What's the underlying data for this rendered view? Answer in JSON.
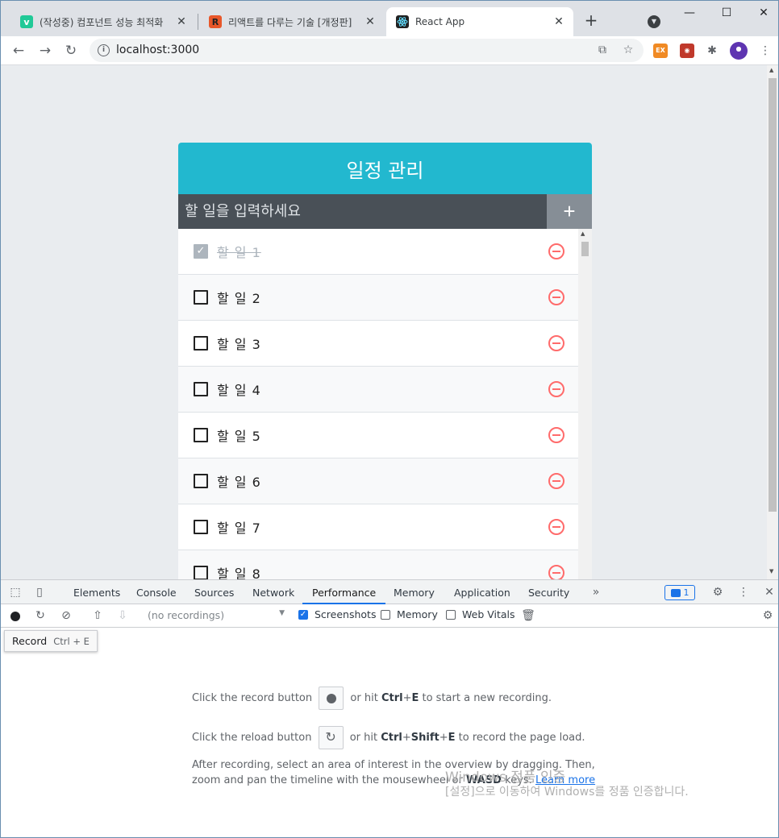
{
  "browser": {
    "tabs": [
      {
        "title": "(작성중) 컴포넌트 성능 최적화",
        "favicon": "v"
      },
      {
        "title": "리액트를 다루는 기술 [개정판]",
        "favicon": "R"
      },
      {
        "title": "React App",
        "favicon": "react-atom"
      }
    ],
    "url": "localhost:3000",
    "close_glyph": "✕",
    "new_tab_glyph": "+"
  },
  "app": {
    "title": "일정 관리",
    "input_placeholder": "할 일을 입력하세요",
    "add_label": "+",
    "todos": [
      {
        "text": "할 일 1",
        "checked": true
      },
      {
        "text": "할 일 2",
        "checked": false
      },
      {
        "text": "할 일 3",
        "checked": false
      },
      {
        "text": "할 일 4",
        "checked": false
      },
      {
        "text": "할 일 5",
        "checked": false
      },
      {
        "text": "할 일 6",
        "checked": false
      },
      {
        "text": "할 일 7",
        "checked": false
      },
      {
        "text": "할 일 8",
        "checked": false
      }
    ]
  },
  "devtools": {
    "tabs": [
      "Elements",
      "Console",
      "Sources",
      "Network",
      "Performance",
      "Memory",
      "Application",
      "Security"
    ],
    "active_tab": "Performance",
    "more_tabs": "»",
    "issues_count": "1",
    "recordings_placeholder": "(no recordings)",
    "checkboxes": [
      {
        "label": "Screenshots",
        "checked": true
      },
      {
        "label": "Memory",
        "checked": false
      },
      {
        "label": "Web Vitals",
        "checked": false
      }
    ],
    "tooltip": {
      "label": "Record",
      "shortcut": "Ctrl + E"
    },
    "landing": {
      "line1_pre": "Click the record button",
      "line1_mid": "or hit",
      "line1_key1": "Ctrl",
      "line1_plus": "+",
      "line1_key2": "E",
      "line1_post": "to start a new recording.",
      "line2_pre": "Click the reload button",
      "line2_mid": "or hit",
      "line2_key1": "Ctrl",
      "line2_key2": "Shift",
      "line2_key3": "E",
      "line2_post": "to record the page load.",
      "line3": "After recording, select an area of interest in the overview by dragging. Then,",
      "line4_pre": "zoom and pan the timeline with the mousewheel or",
      "line4_key": "WASD",
      "line4_post": "keys.",
      "learn_more": "Learn more"
    }
  },
  "watermark": {
    "line1": "Windows 정품 인증",
    "line2": "[설정]으로 이동하여 Windows를 정품 인증합니다."
  },
  "colors": {
    "app_header": "#22b8cf",
    "input_bg": "#495057",
    "add_button": "#868e96",
    "remove_icon": "#ff6b6b",
    "devtools_accent": "#1a73e8"
  }
}
